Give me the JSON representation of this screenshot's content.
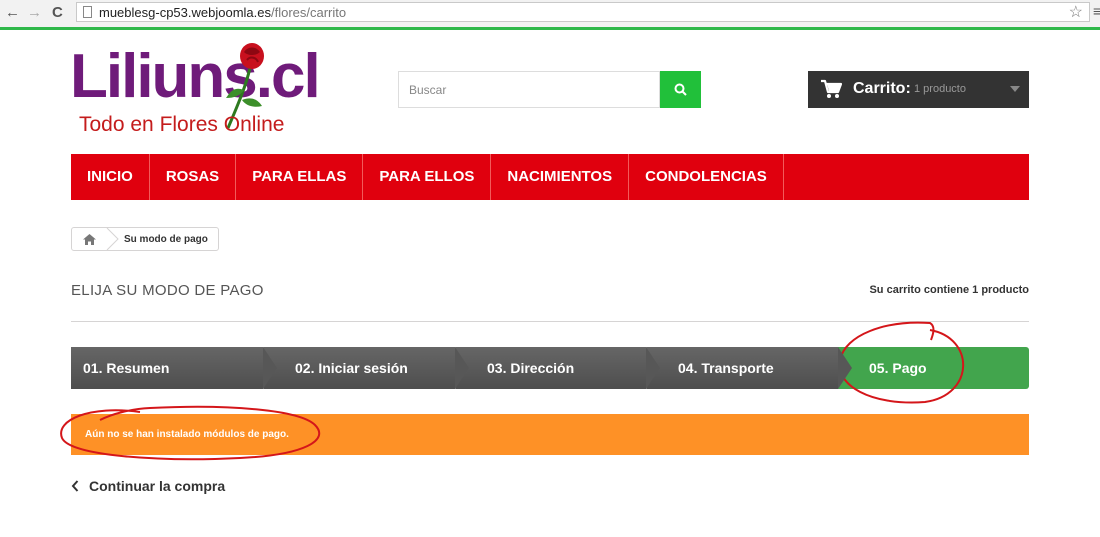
{
  "browser": {
    "url_host": "mueblesg-cp53.webjoomla.es",
    "url_path": "/flores/carrito",
    "back_glyph": "←",
    "forward_glyph": "→",
    "reload_glyph": "C",
    "star_glyph": "☆",
    "menu_glyph": "≡"
  },
  "logo": {
    "name": "Liliuns.cl",
    "tagline": "Todo en Flores Online"
  },
  "search": {
    "placeholder": "Buscar"
  },
  "cart": {
    "label": "Carrito:",
    "count": "1 producto"
  },
  "menu": {
    "items": [
      "INICIO",
      "ROSAS",
      "PARA ELLAS",
      "PARA ELLOS",
      "NACIMIENTOS",
      "CONDOLENCIAS"
    ]
  },
  "breadcrumb": {
    "current": "Su modo de pago"
  },
  "page": {
    "title": "ELIJA SU MODO DE PAGO",
    "cart_summary": "Su carrito contiene 1 producto"
  },
  "steps": [
    {
      "label": "01. Resumen"
    },
    {
      "label": "02. Iniciar sesión"
    },
    {
      "label": "03. Dirección"
    },
    {
      "label": "04. Transporte"
    },
    {
      "label": "05. Pago"
    }
  ],
  "alert": {
    "text": "Aún no se han instalado módulos de pago."
  },
  "continue": {
    "label": "Continuar la compra"
  },
  "colors": {
    "menu_red": "#e0000e",
    "search_green": "#21c03a",
    "step_active_green": "#42a54d",
    "alert_orange": "#fe9126",
    "logo_purple": "#6f1b7a"
  }
}
